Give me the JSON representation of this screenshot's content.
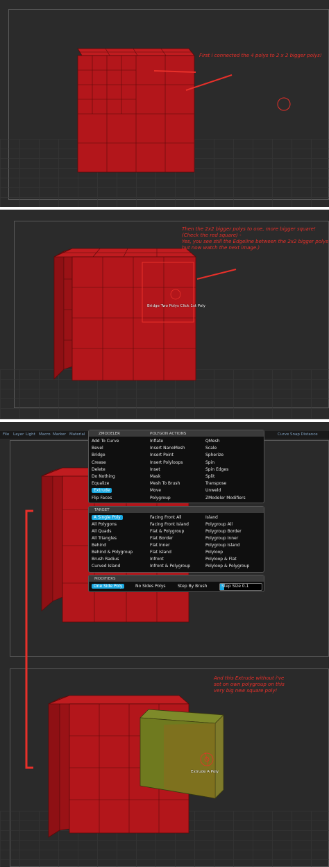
{
  "colors": {
    "poly_red": "#b3161b",
    "poly_edge": "#5a0a0a",
    "poly_green": "#6f7a1f",
    "accent_blue": "#1aa8e0",
    "annotation": "#e8302a"
  },
  "notes": {
    "n1": "First i connected the 4 polys to 2 x 2 bigger polys!",
    "n2": "Then the 2x2 bigger polys to one, more bigger square!\n(Check the red  square) -\nYes, you see still the Edgeline between the 2x2 bigger polys\nbut now watch the next image.)",
    "n3": "And this Extrude without i've\nset on own polygroup on this\nvery big new square poly!"
  },
  "hud": {
    "bridge": "Bridge  Two  Polys  Click  1st  Poly",
    "extrude": "Extrude  A  Poly"
  },
  "menubar": {
    "items": [
      "File",
      "Layer",
      "Light",
      "Macro",
      "Marker",
      "Material"
    ],
    "right": "Curve  Snap  Distance"
  },
  "zmodeler": {
    "header_left": "ZMODELER",
    "header_right": "POLYGON ACTIONS",
    "col1": [
      "Add To Curve",
      "Bevel",
      "Bridge",
      "Crease",
      "Delete",
      "Do Nothing",
      "Equalize",
      "Extrude",
      "Flip Faces"
    ],
    "col2": [
      "Inflate",
      "Insert NanoMesh",
      "Insert Point",
      "Insert Polyloops",
      "Inset",
      "Mask",
      "Mesh To Brush",
      "Move",
      "Polygroup"
    ],
    "col3": [
      "QMesh",
      "Scale",
      "Spherize",
      "Spin",
      "Spin Edges",
      "Split",
      "Transpose",
      "Unweld",
      "ZModeler Modifiers"
    ],
    "selected": "Extrude"
  },
  "target": {
    "header": "TARGET",
    "col1": [
      "A Single Poly",
      "All Polygons",
      "All Quads",
      "All Triangles",
      "Behind",
      "Behind & Polygroup",
      "Brush Radius",
      "Curved Island"
    ],
    "col2": [
      "Facing Front All",
      "Facing Front Island",
      "Flat & Polygroup",
      "Flat Border",
      "Flat Inner",
      "Flat Island",
      "Infront",
      "Infront & Polygroup"
    ],
    "col3": [
      "Island",
      "Polygroup All",
      "Polygroup Border",
      "Polygroup Inner",
      "Polygroup Island",
      "Polyloop",
      "Polyloop & Flat",
      "Polyloop & Polygroup"
    ],
    "selected": "A Single Poly"
  },
  "modifiers": {
    "header": "MODIFIERS",
    "items": [
      "One Side Poly",
      "No Sides Polys",
      "Step By Brush"
    ],
    "selected": "One Side Poly",
    "step_label": "Step Size 0.1",
    "step_fraction": 0.1
  }
}
